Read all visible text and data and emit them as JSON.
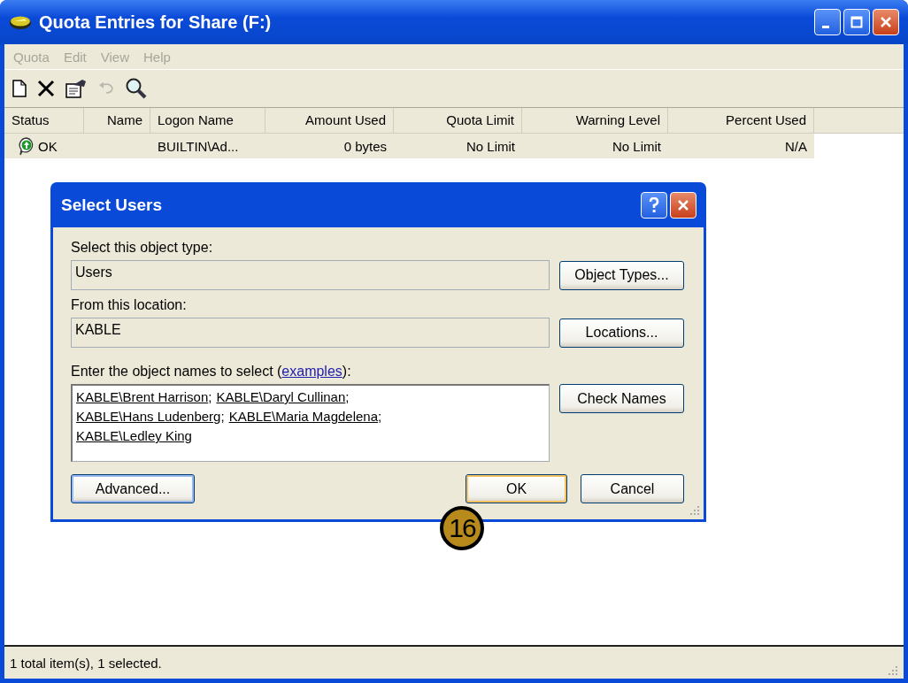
{
  "window": {
    "title": "Quota Entries for Share (F:)"
  },
  "menu": [
    {
      "label": "Quota",
      "disabled": true
    },
    {
      "label": "Edit",
      "disabled": true
    },
    {
      "label": "View",
      "disabled": true
    },
    {
      "label": "Help",
      "disabled": true
    }
  ],
  "toolbar": [
    {
      "kind": "new",
      "disabled": false
    },
    {
      "kind": "delete",
      "disabled": false
    },
    {
      "kind": "properties",
      "disabled": false
    },
    {
      "kind": "undo",
      "disabled": true
    },
    {
      "kind": "find",
      "disabled": false
    }
  ],
  "table": {
    "columns": [
      {
        "label": "Status"
      },
      {
        "label": "Name"
      },
      {
        "label": "Logon Name"
      },
      {
        "label": "Amount Used"
      },
      {
        "label": "Quota Limit"
      },
      {
        "label": "Warning Level"
      },
      {
        "label": "Percent Used"
      }
    ],
    "rows": [
      {
        "selected": true,
        "cells": [
          "OK",
          "",
          "BUILTIN\\Ad...",
          "0 bytes",
          "No Limit",
          "No Limit",
          "N/A"
        ]
      }
    ]
  },
  "dialog": {
    "title": "Select Users",
    "object_type_label": "Select this object type:",
    "object_type": "Users",
    "object_types_button": "Object Types...",
    "location_label": "From this location:",
    "location": "KABLE",
    "locations_button": "Locations...",
    "names_label_before": "Enter the object names to select (",
    "names_label_link": "examples",
    "names_label_after": "):",
    "names": [
      [
        {
          "name": "KABLE\\Brent Harrison",
          "separator": ";"
        },
        {
          "name": "KABLE\\Daryl Cullinan",
          "separator": ";"
        }
      ],
      [
        {
          "name": "KABLE\\Hans Ludenberg",
          "separator": ";"
        },
        {
          "name": "KABLE\\Maria Magdelena",
          "separator": ";"
        }
      ],
      [
        {
          "name": "KABLE\\Ledley King"
        }
      ]
    ],
    "check_names_button": "Check Names",
    "advanced_button": "Advanced...",
    "ok_button": "OK",
    "cancel_button": "Cancel"
  },
  "callout": "16",
  "status_bar": "1 total item(s), 1 selected."
}
